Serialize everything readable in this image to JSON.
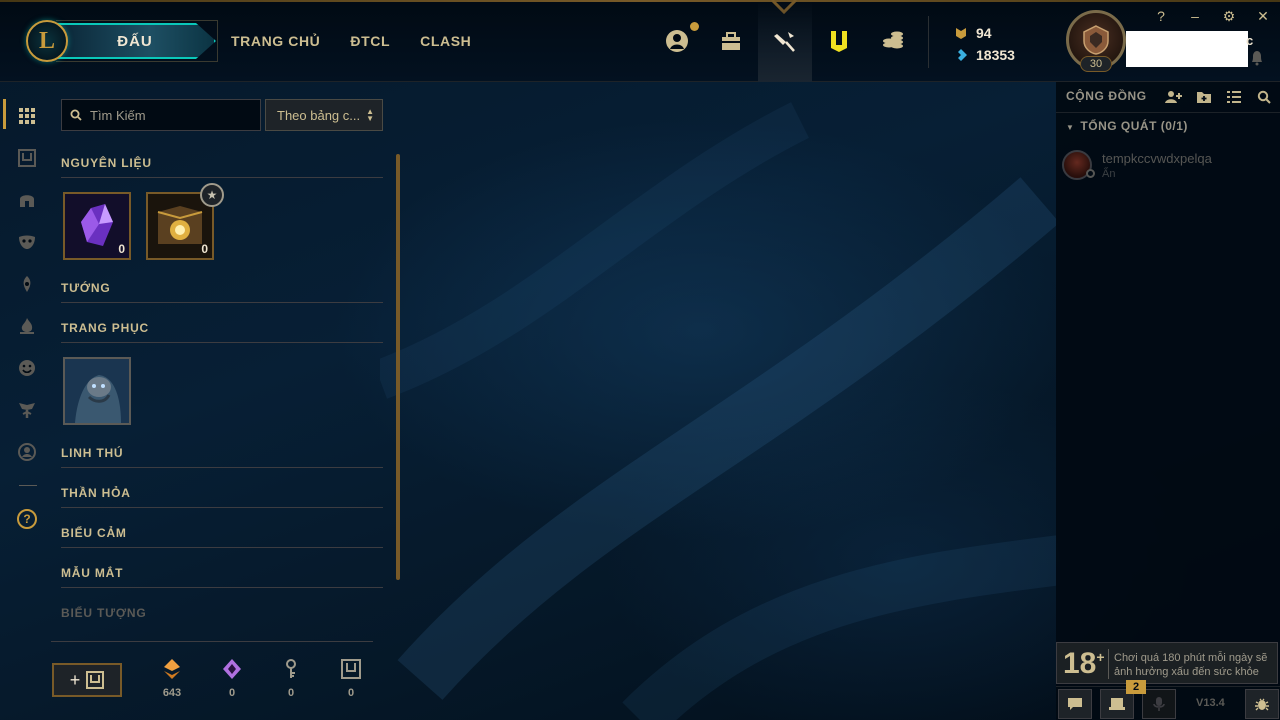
{
  "nav": {
    "play_label": "ĐẤU",
    "logo_letter": "L",
    "links": [
      "TRANG CHỦ",
      "ĐTCL",
      "CLASH"
    ],
    "icons": [
      "profile-icon",
      "collection-bag-icon",
      "loot-hammer-icon",
      "collection-icon",
      "store-coins-icon"
    ],
    "currency": {
      "rp": "94",
      "blue_essence": "18353"
    },
    "profile": {
      "level": "30"
    },
    "name_suffix": "c",
    "window_controls": [
      "?",
      "–",
      "⚙",
      "✕"
    ]
  },
  "rail": {
    "icons": [
      "grid-icon",
      "chest-icon",
      "champion-helmet-icon",
      "skin-mask-icon",
      "ward-icon",
      "emote-flame-icon",
      "emote-face-icon",
      "wings-icon",
      "profile-circle-icon"
    ],
    "help_label": "?"
  },
  "collection": {
    "search_placeholder": "Tìm Kiếm",
    "sort_label": "Theo bảng c...",
    "sections": {
      "materials": "NGUYÊN LIỆU",
      "champions": "TƯỚNG",
      "skins": "TRANG PHỤC",
      "pets": "LINH THÚ",
      "wards": "THẦN HỎA",
      "emotes": "BIỂU CẢM",
      "chromas": "MẪU MẮT",
      "icons": "BIỂU TƯỢNG"
    },
    "materials": [
      {
        "name": "mythic-essence",
        "count": "0"
      },
      {
        "name": "masterwork-chest",
        "count": "0"
      }
    ],
    "skins": [
      {
        "name": "skin-tile"
      }
    ]
  },
  "footer": {
    "craft_label": "+",
    "resources": [
      {
        "icon": "orange-essence-icon",
        "value": "643",
        "color": "#f0a040"
      },
      {
        "icon": "mythic-essence-icon",
        "value": "0",
        "color": "#b070e0"
      },
      {
        "icon": "key-icon",
        "value": "0",
        "color": "#a09b8c"
      },
      {
        "icon": "chest-icon",
        "value": "0",
        "color": "#a09b8c"
      }
    ]
  },
  "social": {
    "header": "CỘNG ĐỒNG",
    "group": "TỔNG QUÁT (0/1)",
    "friends": [
      {
        "name": "tempkccvwdxpelqa",
        "status": "Ẩn"
      }
    ],
    "warning_age": "18",
    "warning_text": "Chơi quá 180 phút mỗi ngày sẽ ảnh hưởng xấu đến sức khỏe",
    "missions_badge": "2",
    "version": "V13.4"
  },
  "colors": {
    "gold": "#c89b3c",
    "teal": "#0ac8b9",
    "bg": "#010a13"
  }
}
